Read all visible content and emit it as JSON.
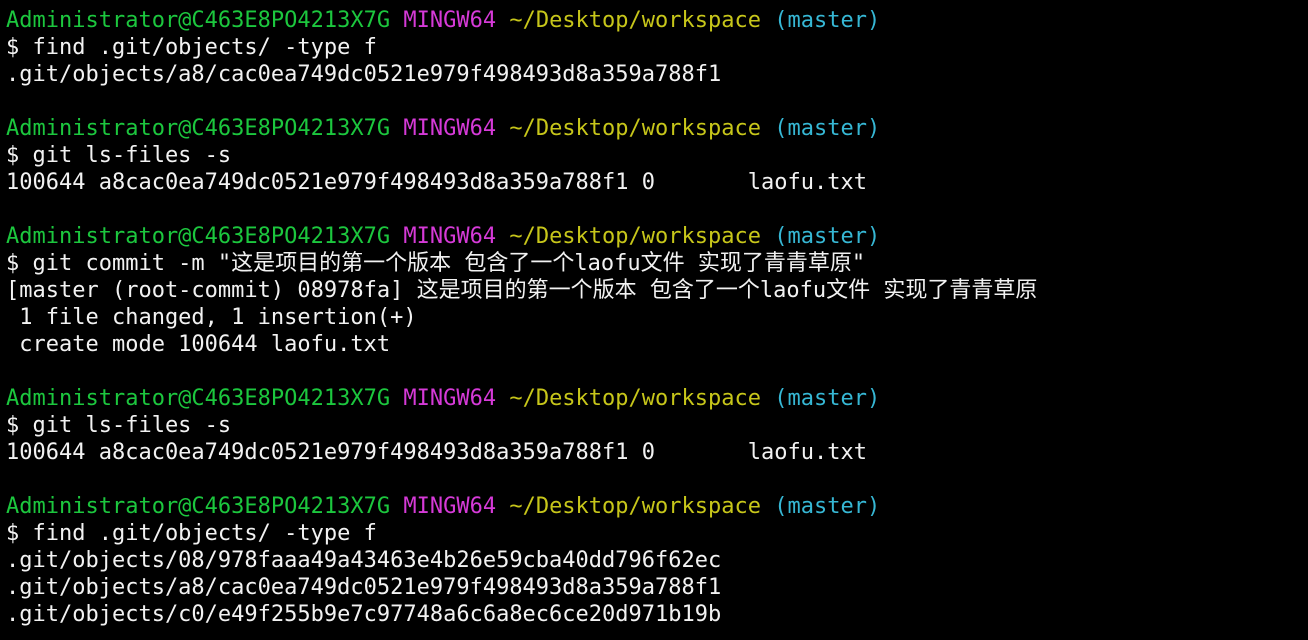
{
  "prompt": {
    "user_host": "Administrator@C463E8PO4213X7G",
    "env": "MINGW64",
    "path": "~/Desktop/workspace",
    "branch": "(master)"
  },
  "colors": {
    "background": "#000000",
    "user_host": "#1cc73e",
    "env": "#d63ad8",
    "path": "#c7c61a",
    "branch": "#36b7d4",
    "text": "#f2f2f2"
  },
  "blocks": [
    {
      "command": "$ find .git/objects/ -type f",
      "output": [
        ".git/objects/a8/cac0ea749dc0521e979f498493d8a359a788f1"
      ]
    },
    {
      "command": "$ git ls-files -s",
      "output": [
        "100644 a8cac0ea749dc0521e979f498493d8a359a788f1 0       laofu.txt"
      ]
    },
    {
      "command": "$ git commit -m \"这是项目的第一个版本 包含了一个laofu文件 实现了青青草原\"",
      "output": [
        "[master (root-commit) 08978fa] 这是项目的第一个版本 包含了一个laofu文件 实现了青青草原",
        " 1 file changed, 1 insertion(+)",
        " create mode 100644 laofu.txt"
      ]
    },
    {
      "command": "$ git ls-files -s",
      "output": [
        "100644 a8cac0ea749dc0521e979f498493d8a359a788f1 0       laofu.txt"
      ]
    },
    {
      "command": "$ find .git/objects/ -type f",
      "output": [
        ".git/objects/08/978faaa49a43463e4b26e59cba40dd796f62ec",
        ".git/objects/a8/cac0ea749dc0521e979f498493d8a359a788f1",
        ".git/objects/c0/e49f255b9e7c97748a6c6a8ec6ce20d971b19b"
      ]
    }
  ]
}
